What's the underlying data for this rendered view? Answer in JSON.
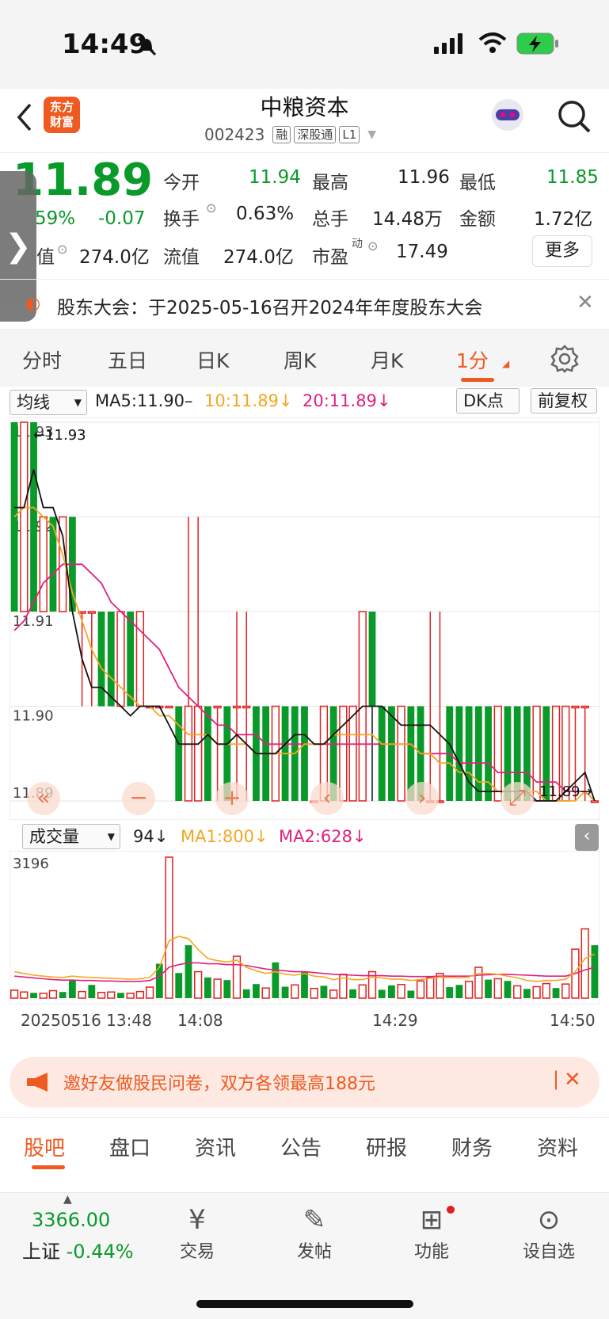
{
  "status_bar": {
    "time": "14:49"
  },
  "header": {
    "logo_text_line1": "东方",
    "logo_text_line2": "财富",
    "title": "中粮资本",
    "code": "002423",
    "tags": [
      "融",
      "深股通",
      "L1"
    ]
  },
  "quote": {
    "price": "11.89",
    "change_pct": "-0.59%",
    "change_pct_display": "59%",
    "change": "-0.07",
    "total_mv_label": "值",
    "total_mv": "274.0亿",
    "open_label": "今开",
    "open": "11.94",
    "high_label": "最高",
    "high": "11.96",
    "low_label": "最低",
    "low": "11.85",
    "turnover_label": "换手",
    "turnover": "0.63%",
    "volume_label": "总手",
    "volume": "14.48万",
    "amount_label": "金额",
    "amount": "1.72亿",
    "float_mv_label": "流值",
    "float_mv": "274.0亿",
    "pe_label": "市盈",
    "pe_sup": "动",
    "pe": "17.49",
    "more_label": "更多"
  },
  "notice": {
    "text": "股东大会：于2025-05-16召开2024年年度股东大会"
  },
  "period_tabs": [
    "分时",
    "五日",
    "日K",
    "周K",
    "月K",
    "1分"
  ],
  "period_active": "1分",
  "indicator_bar": {
    "ma_select": "均线",
    "ma5": "MA5:11.90–",
    "ma10": "10:11.89",
    "ma20": "20:11.89",
    "dk_label": "DK点",
    "adjust_label": "前复权"
  },
  "volume_bar": {
    "select": "成交量",
    "value": "94",
    "ma1": "MA1:800",
    "ma2": "MA2:628"
  },
  "colors": {
    "accent": "#ef5a21",
    "up": "#e02020",
    "down": "#0a9a2a",
    "ma5": "#111111",
    "ma10": "#f5a623",
    "ma20": "#e0207f"
  },
  "chart_data": [
    {
      "type": "candlestick",
      "title": "",
      "y_ticks": [
        "11.93",
        "11.92",
        "11.91",
        "11.90",
        "11.89"
      ],
      "ylim": [
        11.89,
        11.93
      ],
      "annotations": [
        "11.93",
        "11.89"
      ],
      "candles": [
        {
          "o": 11.93,
          "c": 11.91,
          "h": 11.93,
          "l": 11.91
        },
        {
          "o": 11.91,
          "c": 11.93,
          "h": 11.93,
          "l": 11.91
        },
        {
          "o": 11.93,
          "c": 11.91,
          "h": 11.93,
          "l": 11.91
        },
        {
          "o": 11.91,
          "c": 11.92,
          "h": 11.92,
          "l": 11.91
        },
        {
          "o": 11.92,
          "c": 11.91,
          "h": 11.92,
          "l": 11.91
        },
        {
          "o": 11.91,
          "c": 11.92,
          "h": 11.92,
          "l": 11.91
        },
        {
          "o": 11.92,
          "c": 11.91,
          "h": 11.92,
          "l": 11.91
        },
        {
          "o": 11.91,
          "c": 11.91,
          "h": 11.91,
          "l": 11.9
        },
        {
          "o": 11.91,
          "c": 11.91,
          "h": 11.91,
          "l": 11.9
        },
        {
          "o": 11.91,
          "c": 11.9,
          "h": 11.91,
          "l": 11.9
        },
        {
          "o": 11.91,
          "c": 11.9,
          "h": 11.91,
          "l": 11.9
        },
        {
          "o": 11.9,
          "c": 11.91,
          "h": 11.91,
          "l": 11.9
        },
        {
          "o": 11.91,
          "c": 11.9,
          "h": 11.91,
          "l": 11.9
        },
        {
          "o": 11.9,
          "c": 11.91,
          "h": 11.91,
          "l": 11.9
        },
        {
          "o": 11.9,
          "c": 11.9,
          "h": 11.9,
          "l": 11.9
        },
        {
          "o": 11.9,
          "c": 11.9,
          "h": 11.9,
          "l": 11.9
        },
        {
          "o": 11.9,
          "c": 11.9,
          "h": 11.9,
          "l": 11.9
        },
        {
          "o": 11.9,
          "c": 11.89,
          "h": 11.9,
          "l": 11.89
        },
        {
          "o": 11.89,
          "c": 11.9,
          "h": 11.92,
          "l": 11.89
        },
        {
          "o": 11.89,
          "c": 11.9,
          "h": 11.92,
          "l": 11.89
        },
        {
          "o": 11.9,
          "c": 11.89,
          "h": 11.9,
          "l": 11.89
        },
        {
          "o": 11.9,
          "c": 11.9,
          "h": 11.9,
          "l": 11.89
        },
        {
          "o": 11.9,
          "c": 11.89,
          "h": 11.9,
          "l": 11.89
        },
        {
          "o": 11.9,
          "c": 11.9,
          "h": 11.91,
          "l": 11.89
        },
        {
          "o": 11.9,
          "c": 11.9,
          "h": 11.91,
          "l": 11.89
        },
        {
          "o": 11.9,
          "c": 11.89,
          "h": 11.9,
          "l": 11.89
        },
        {
          "o": 11.9,
          "c": 11.89,
          "h": 11.9,
          "l": 11.89
        },
        {
          "o": 11.89,
          "c": 11.9,
          "h": 11.9,
          "l": 11.89
        },
        {
          "o": 11.9,
          "c": 11.89,
          "h": 11.9,
          "l": 11.89
        },
        {
          "o": 11.9,
          "c": 11.89,
          "h": 11.9,
          "l": 11.89
        },
        {
          "o": 11.9,
          "c": 11.89,
          "h": 11.9,
          "l": 11.89
        },
        {
          "o": 11.89,
          "c": 11.89,
          "h": 11.89,
          "l": 11.89
        },
        {
          "o": 11.89,
          "c": 11.9,
          "h": 11.9,
          "l": 11.89
        },
        {
          "o": 11.9,
          "c": 11.89,
          "h": 11.9,
          "l": 11.89
        },
        {
          "o": 11.89,
          "c": 11.9,
          "h": 11.9,
          "l": 11.89
        },
        {
          "o": 11.89,
          "c": 11.9,
          "h": 11.9,
          "l": 11.89
        },
        {
          "o": 11.89,
          "c": 11.91,
          "h": 11.91,
          "l": 11.89
        },
        {
          "o": 11.91,
          "c": 11.9,
          "h": 11.91,
          "l": 11.89
        },
        {
          "o": 11.9,
          "c": 11.89,
          "h": 11.9,
          "l": 11.89
        },
        {
          "o": 11.9,
          "c": 11.89,
          "h": 11.9,
          "l": 11.89
        },
        {
          "o": 11.89,
          "c": 11.9,
          "h": 11.9,
          "l": 11.89
        },
        {
          "o": 11.9,
          "c": 11.89,
          "h": 11.9,
          "l": 11.89
        },
        {
          "o": 11.9,
          "c": 11.89,
          "h": 11.9,
          "l": 11.89
        },
        {
          "o": 11.89,
          "c": 11.89,
          "h": 11.91,
          "l": 11.89
        },
        {
          "o": 11.89,
          "c": 11.89,
          "h": 11.91,
          "l": 11.89
        },
        {
          "o": 11.9,
          "c": 11.89,
          "h": 11.9,
          "l": 11.89
        },
        {
          "o": 11.9,
          "c": 11.89,
          "h": 11.9,
          "l": 11.89
        },
        {
          "o": 11.9,
          "c": 11.89,
          "h": 11.9,
          "l": 11.89
        },
        {
          "o": 11.9,
          "c": 11.89,
          "h": 11.9,
          "l": 11.89
        },
        {
          "o": 11.9,
          "c": 11.89,
          "h": 11.9,
          "l": 11.89
        },
        {
          "o": 11.89,
          "c": 11.9,
          "h": 11.9,
          "l": 11.89
        },
        {
          "o": 11.9,
          "c": 11.89,
          "h": 11.9,
          "l": 11.89
        },
        {
          "o": 11.9,
          "c": 11.89,
          "h": 11.9,
          "l": 11.89
        },
        {
          "o": 11.9,
          "c": 11.89,
          "h": 11.9,
          "l": 11.89
        },
        {
          "o": 11.89,
          "c": 11.9,
          "h": 11.9,
          "l": 11.89
        },
        {
          "o": 11.9,
          "c": 11.89,
          "h": 11.9,
          "l": 11.89
        },
        {
          "o": 11.89,
          "c": 11.9,
          "h": 11.9,
          "l": 11.89
        },
        {
          "o": 11.89,
          "c": 11.9,
          "h": 11.9,
          "l": 11.89
        },
        {
          "o": 11.9,
          "c": 11.9,
          "h": 11.9,
          "l": 11.89
        },
        {
          "o": 11.9,
          "c": 11.9,
          "h": 11.9,
          "l": 11.89
        },
        {
          "o": 11.89,
          "c": 11.89,
          "h": 11.89,
          "l": 11.89
        }
      ],
      "ma5": [
        11.921,
        11.921,
        11.925,
        11.921,
        11.921,
        11.918,
        11.91,
        11.905,
        11.902,
        11.902,
        11.901,
        11.9,
        11.899,
        11.9,
        11.9,
        11.9,
        11.898,
        11.896,
        11.896,
        11.896,
        11.897,
        11.896,
        11.896,
        11.897,
        11.896,
        11.895,
        11.895,
        11.895,
        11.896,
        11.897,
        11.897,
        11.896,
        11.896,
        11.897,
        11.898,
        11.899,
        11.9,
        11.9,
        11.9,
        11.899,
        11.898,
        11.898,
        11.898,
        11.898,
        11.897,
        11.896,
        11.894,
        11.892,
        11.891,
        11.891,
        11.891,
        11.891,
        11.891,
        11.891,
        11.89,
        11.89,
        11.89,
        11.891,
        11.892,
        11.893,
        11.89
      ],
      "ma10": [
        11.92,
        11.921,
        11.921,
        11.92,
        11.919,
        11.916,
        11.912,
        11.909,
        11.906,
        11.904,
        11.903,
        11.902,
        11.901,
        11.9,
        11.9,
        11.899,
        11.899,
        11.898,
        11.897,
        11.897,
        11.897,
        11.896,
        11.896,
        11.896,
        11.896,
        11.895,
        11.895,
        11.895,
        11.895,
        11.895,
        11.896,
        11.896,
        11.896,
        11.897,
        11.897,
        11.897,
        11.897,
        11.897,
        11.896,
        11.896,
        11.896,
        11.896,
        11.895,
        11.895,
        11.894,
        11.894,
        11.893,
        11.893,
        11.892,
        11.892,
        11.891,
        11.891,
        11.891,
        11.891,
        11.891,
        11.89,
        11.89,
        11.89,
        11.89,
        11.891,
        11.89
      ],
      "ma20": [
        11.908,
        11.909,
        11.911,
        11.913,
        11.914,
        11.915,
        11.915,
        11.915,
        11.914,
        11.913,
        11.911,
        11.91,
        11.909,
        11.908,
        11.907,
        11.906,
        11.904,
        11.902,
        11.901,
        11.9,
        11.899,
        11.898,
        11.898,
        11.897,
        11.897,
        11.897,
        11.896,
        11.896,
        11.896,
        11.896,
        11.896,
        11.896,
        11.896,
        11.896,
        11.896,
        11.896,
        11.896,
        11.896,
        11.896,
        11.896,
        11.896,
        11.896,
        11.895,
        11.895,
        11.895,
        11.895,
        11.894,
        11.894,
        11.894,
        11.894,
        11.893,
        11.893,
        11.893,
        11.893,
        11.892,
        11.892,
        11.892,
        11.891,
        11.891,
        11.891,
        11.89
      ]
    },
    {
      "type": "bar",
      "title": "",
      "y_ticks": [
        "3196"
      ],
      "ylim": [
        0,
        3196
      ],
      "x_ticks": [
        "20250516 13:48",
        "14:08",
        "14:29",
        "14:50"
      ],
      "values": [
        180,
        140,
        120,
        110,
        170,
        140,
        420,
        150,
        300,
        130,
        140,
        120,
        110,
        150,
        250,
        780,
        3196,
        570,
        1200,
        600,
        470,
        430,
        410,
        950,
        200,
        320,
        230,
        810,
        260,
        300,
        610,
        220,
        280,
        180,
        540,
        200,
        300,
        600,
        190,
        290,
        310,
        170,
        390,
        470,
        560,
        250,
        300,
        380,
        700,
        420,
        440,
        390,
        280,
        210,
        260,
        330,
        230,
        320,
        1110,
        1570,
        1200
      ],
      "colors_up": [
        true,
        true,
        false,
        true,
        true,
        false,
        false,
        true,
        false,
        true,
        true,
        false,
        true,
        true,
        true,
        false,
        true,
        false,
        false,
        true,
        false,
        true,
        false,
        true,
        false,
        false,
        true,
        false,
        false,
        true,
        false,
        true,
        false,
        true,
        true,
        false,
        true,
        true,
        false,
        false,
        true,
        false,
        true,
        true,
        true,
        false,
        false,
        true,
        true,
        false,
        true,
        false,
        true,
        false,
        true,
        true,
        false,
        true,
        true,
        true,
        false
      ],
      "ma1": [
        600,
        560,
        520,
        500,
        480,
        470,
        500,
        480,
        470,
        460,
        450,
        440,
        430,
        440,
        470,
        700,
        1300,
        1400,
        1350,
        1100,
        900,
        850,
        820,
        860,
        700,
        620,
        560,
        600,
        540,
        520,
        560,
        500,
        480,
        420,
        460,
        420,
        420,
        480,
        460,
        430,
        430,
        400,
        420,
        450,
        480,
        470,
        460,
        480,
        560,
        560,
        540,
        500,
        460,
        400,
        380,
        400,
        400,
        430,
        600,
        900,
        1000
      ],
      "ma2": [
        500,
        480,
        460,
        440,
        420,
        410,
        410,
        400,
        400,
        390,
        390,
        380,
        380,
        380,
        400,
        500,
        700,
        760,
        800,
        800,
        780,
        780,
        760,
        760,
        740,
        700,
        660,
        640,
        620,
        600,
        600,
        580,
        560,
        540,
        530,
        520,
        510,
        510,
        510,
        500,
        500,
        490,
        490,
        490,
        500,
        500,
        500,
        500,
        520,
        530,
        540,
        540,
        530,
        520,
        510,
        500,
        500,
        500,
        560,
        640,
        700
      ]
    }
  ],
  "promo": {
    "text": "邀好友做股民问卷，双方各领最高188元"
  },
  "content_tabs": [
    "股吧",
    "盘口",
    "资讯",
    "公告",
    "研报",
    "财务",
    "资料"
  ],
  "content_active": "股吧",
  "bottom_bar": {
    "index_value": "3366.00",
    "index_label": "上证",
    "index_change": "-0.44%",
    "items": [
      {
        "label": "交易",
        "icon": "yen-circle-icon"
      },
      {
        "label": "发帖",
        "icon": "edit-icon"
      },
      {
        "label": "功能",
        "icon": "grid-icon"
      },
      {
        "label": "设自选",
        "icon": "more-circle-icon"
      }
    ]
  }
}
